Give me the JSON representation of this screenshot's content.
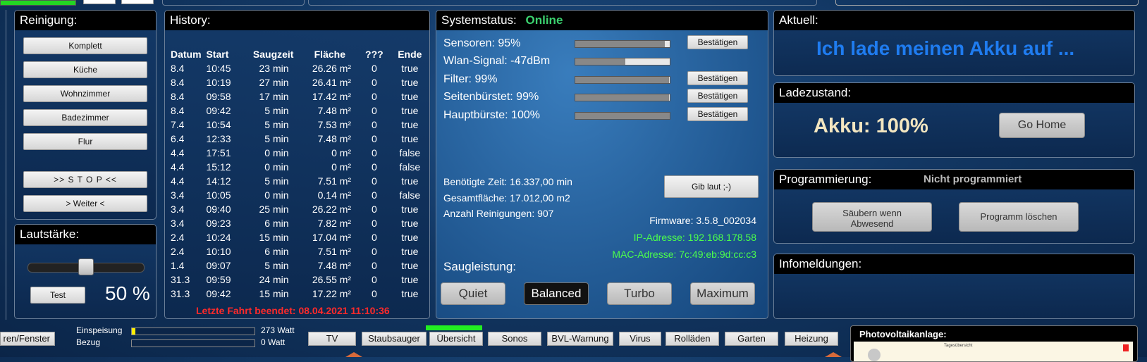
{
  "reinigung": {
    "title": "Reinigung:",
    "buttons": [
      "Komplett",
      "Küche",
      "Wohnzimmer",
      "Badezimmer",
      "Flur"
    ],
    "stop_label": ">> S T O P <<",
    "weiter_label": "> Weiter <"
  },
  "lautstaerke": {
    "title": "Lautstärke:",
    "test_label": "Test",
    "value_text": "50 %",
    "level": 0.5
  },
  "history": {
    "title": "History:",
    "columns": [
      "Datum",
      "Start",
      "Saugzeit",
      "Fläche",
      "???",
      "Ende"
    ],
    "rows": [
      [
        "8.4",
        "10:45",
        "23 min",
        "26.26 m²",
        "0",
        "true"
      ],
      [
        "8.4",
        "10:19",
        "27 min",
        "26.41 m²",
        "0",
        "true"
      ],
      [
        "8.4",
        "09:58",
        "17 min",
        "17.42 m²",
        "0",
        "true"
      ],
      [
        "8.4",
        "09:42",
        "5 min",
        "7.48 m²",
        "0",
        "true"
      ],
      [
        "7.4",
        "10:54",
        "5 min",
        "7.53 m²",
        "0",
        "true"
      ],
      [
        "6.4",
        "12:33",
        "5 min",
        "7.48 m²",
        "0",
        "true"
      ],
      [
        "4.4",
        "17:51",
        "0 min",
        "0 m²",
        "0",
        "false"
      ],
      [
        "4.4",
        "15:12",
        "0 min",
        "0 m²",
        "0",
        "false"
      ],
      [
        "4.4",
        "14:12",
        "5 min",
        "7.51 m²",
        "0",
        "true"
      ],
      [
        "3.4",
        "10:05",
        "0 min",
        "0.14 m²",
        "0",
        "false"
      ],
      [
        "3.4",
        "09:40",
        "25 min",
        "26.22 m²",
        "0",
        "true"
      ],
      [
        "3.4",
        "09:23",
        "6 min",
        "7.82 m²",
        "0",
        "true"
      ],
      [
        "2.4",
        "10:24",
        "15 min",
        "17.04 m²",
        "0",
        "true"
      ],
      [
        "2.4",
        "10:10",
        "6 min",
        "7.51 m²",
        "0",
        "true"
      ],
      [
        "1.4",
        "09:07",
        "5 min",
        "7.48 m²",
        "0",
        "true"
      ],
      [
        "31.3",
        "09:59",
        "24 min",
        "26.55 m²",
        "0",
        "true"
      ],
      [
        "31.3",
        "09:42",
        "15 min",
        "17.22 m²",
        "0",
        "true"
      ]
    ],
    "last_run": "Letzte Fahrt beendet: 08.04.2021 11:10:36"
  },
  "systemstatus": {
    "title": "Systemstatus:",
    "status": "Online",
    "bars": [
      {
        "label": "Sensoren: 95%",
        "value": 0.95,
        "confirm": "Bestätigen"
      },
      {
        "label": "Wlan-Signal: -47dBm",
        "value": 0.53,
        "confirm": ""
      },
      {
        "label": "Filter: 99%",
        "value": 0.99,
        "confirm": "Bestätigen"
      },
      {
        "label": "Seitenbürstet: 99%",
        "value": 0.99,
        "confirm": "Bestätigen"
      },
      {
        "label": "Hauptbürste: 100%",
        "value": 1.0,
        "confirm": "Bestätigen"
      }
    ],
    "time": "Benötigte Zeit: 16.337,00 min",
    "area": "Gesamtfläche: 17.012,00 m2",
    "count": "Anzahl Reinigungen: 907",
    "beep_label": "Gib laut ;-)",
    "firmware": "Firmware: 3.5.8_002034",
    "ip": "IP-Adresse: 192.168.178.58",
    "mac": "MAC-Adresse: 7c:49:eb:9d:cc:c3",
    "saug_title": "Saugleistung:",
    "modes": [
      "Quiet",
      "Balanced",
      "Turbo",
      "Maximum"
    ],
    "active_mode": "Balanced"
  },
  "aktuell": {
    "title": "Aktuell:",
    "message": "Ich lade meinen Akku auf ..."
  },
  "ladezustand": {
    "title": "Ladezustand:",
    "akku": "Akku: 100%",
    "home_label": "Go Home"
  },
  "programmierung": {
    "title": "Programmierung:",
    "status": "Nicht programmiert",
    "absent_label": "Säubern wenn Abwesend",
    "delete_label": "Programm löschen"
  },
  "infomeldungen": {
    "title": "Infomeldungen:"
  },
  "energy": {
    "einspeisung_label": "Einspeisung",
    "einspeisung_value": "273 Watt",
    "einspeisung_level": 0.03,
    "bezug_label": "Bezug",
    "bezug_value": "0 Watt",
    "bezug_level": 0
  },
  "nav": {
    "left_label": "ren/Fenster",
    "items": [
      "TV",
      "Staubsauger",
      "Übersicht",
      "Sonos",
      "BVL-Warnung",
      "Virus",
      "Rolläden",
      "Garten",
      "Heizung"
    ],
    "active": "Übersicht"
  },
  "photovoltaik": {
    "title": "Photovoltaikanlage:",
    "thumb_text": "Tagesübersicht"
  },
  "colors": {
    "online": "#3bd16f",
    "accent_blue": "#1f7cf0",
    "last_run_red": "#ff2a2a",
    "network_green": "#4cff4c",
    "active_nav": "#22ee22",
    "energy_yellow": "#ffee00"
  }
}
